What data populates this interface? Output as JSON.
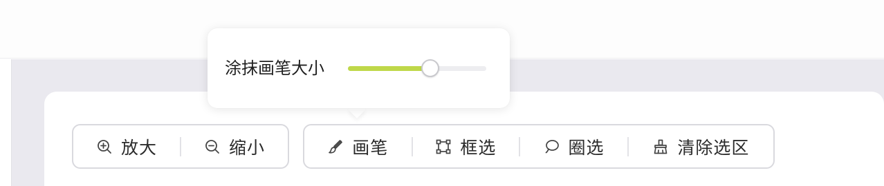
{
  "brush_popover": {
    "label": "涂抹画笔大小",
    "size_fraction": 0.595,
    "fill_color": "#bfd84a"
  },
  "toolbar": {
    "zoom_group": [
      {
        "label": "放大",
        "icon": "zoom-in-icon"
      },
      {
        "label": "缩小",
        "icon": "zoom-out-icon"
      }
    ],
    "selection_group": [
      {
        "label": "画笔",
        "icon": "brush-icon"
      },
      {
        "label": "框选",
        "icon": "box-select-icon"
      },
      {
        "label": "圈选",
        "icon": "lasso-icon"
      },
      {
        "label": "清除选区",
        "icon": "broom-icon"
      }
    ]
  }
}
